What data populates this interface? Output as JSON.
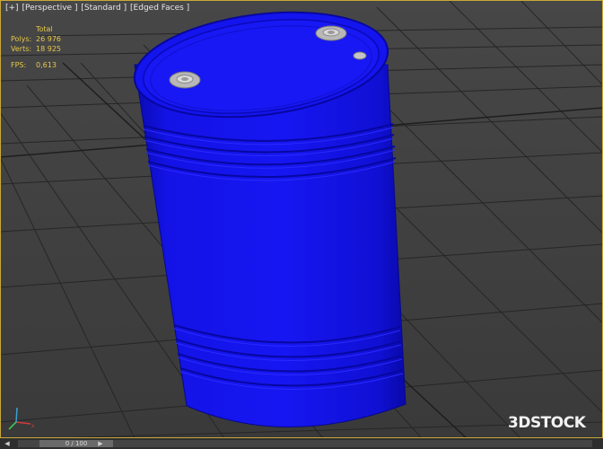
{
  "viewport": {
    "labels": [
      "[+]",
      "[Perspective ]",
      "[Standard ]",
      "[Edged Faces ]"
    ]
  },
  "stats": {
    "header": "Total",
    "polys_label": "Polys:",
    "polys_value": "26 976",
    "verts_label": "Verts:",
    "verts_value": "18 925",
    "fps_label": "FPS:",
    "fps_value": "0,613"
  },
  "watermark": "3DSTOCK",
  "timebar": {
    "frame_readout": "0 / 100",
    "prev_icon": "arrow-left-icon",
    "next_icon": "arrow-right-icon"
  },
  "colors": {
    "barrel": "#1515f0",
    "barrel_dark": "#0b0bb4",
    "viewport_border": "#c9a83a",
    "stats_text": "#e6c84a",
    "grid": "#222222"
  }
}
